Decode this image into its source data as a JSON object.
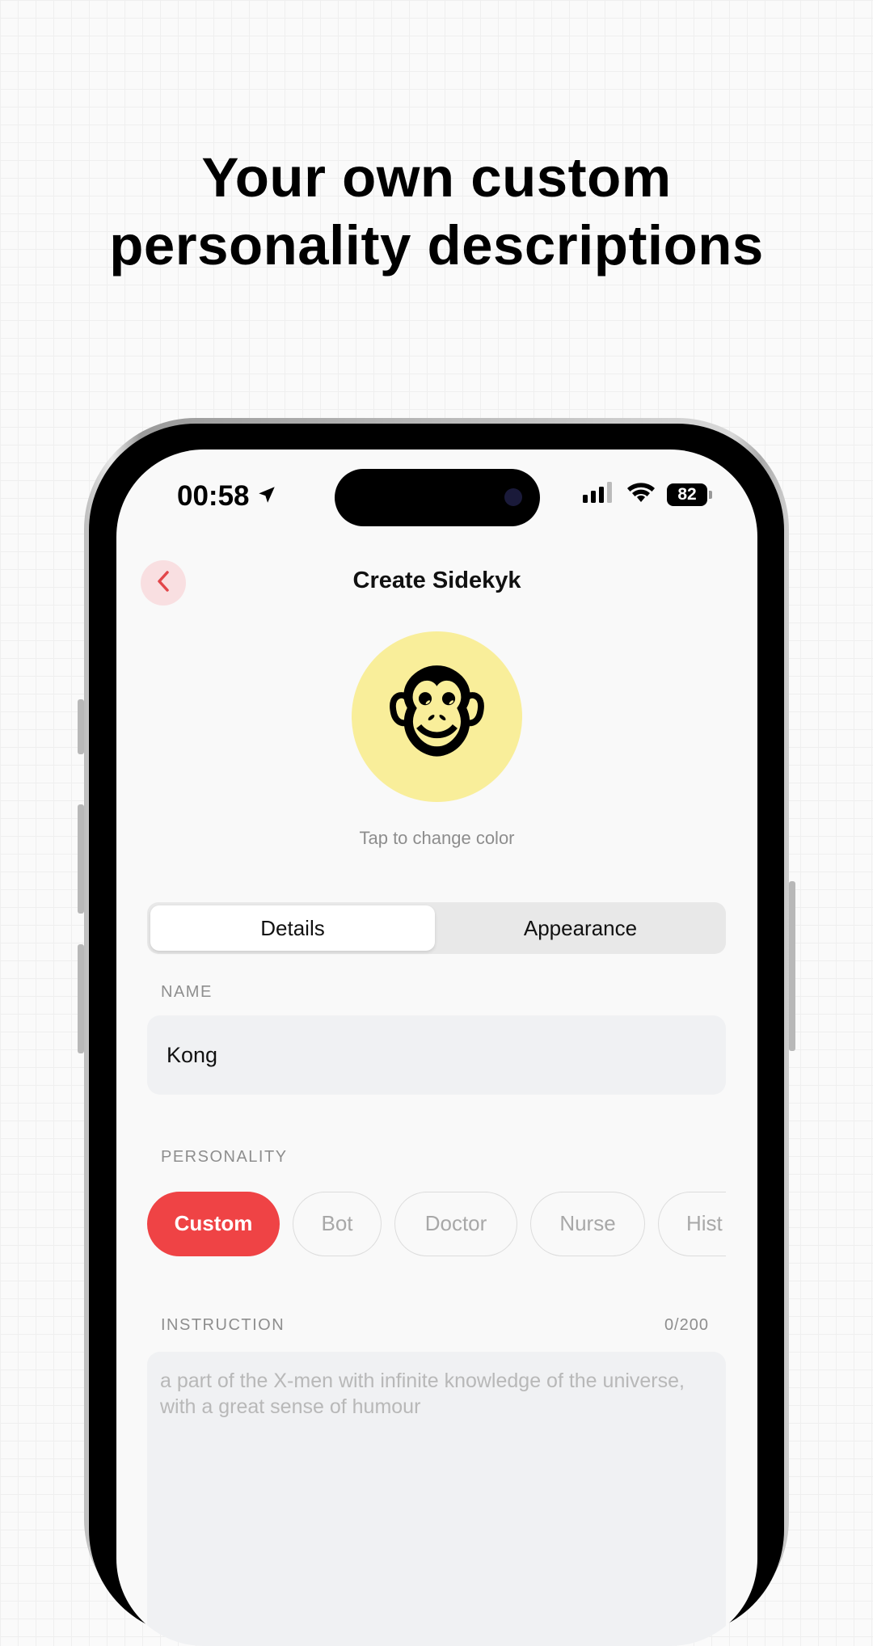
{
  "headline": {
    "line1": "Your own custom",
    "line2": "personality descriptions"
  },
  "status_bar": {
    "time": "00:58",
    "battery": "82",
    "icons": [
      "location-arrow-icon",
      "signal-icon",
      "wifi-icon",
      "battery-icon"
    ]
  },
  "nav": {
    "title": "Create Sidekyk",
    "back_icon": "chevron-left-icon"
  },
  "avatar": {
    "emoji": "🐵",
    "background_color": "#f9ee9a",
    "hint": "Tap to change color"
  },
  "tabs": {
    "items": [
      {
        "label": "Details",
        "selected": true
      },
      {
        "label": "Appearance",
        "selected": false
      }
    ]
  },
  "name_field": {
    "label": "NAME",
    "value": "Kong"
  },
  "personality": {
    "label": "PERSONALITY",
    "chips": [
      {
        "label": "Custom",
        "selected": true
      },
      {
        "label": "Bot",
        "selected": false
      },
      {
        "label": "Doctor",
        "selected": false
      },
      {
        "label": "Nurse",
        "selected": false
      },
      {
        "label": "Hist",
        "selected": false
      }
    ]
  },
  "instruction": {
    "label": "INSTRUCTION",
    "counter": "0/200",
    "placeholder": "a part of the X-men with infinite knowledge of the universe, with a great sense of humour"
  },
  "colors": {
    "accent": "#ef4345",
    "accent_soft": "#f9dfe1",
    "input_bg": "#f0f1f3"
  }
}
